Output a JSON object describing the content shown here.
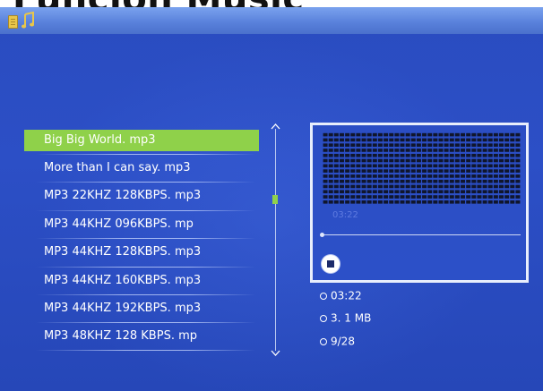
{
  "header": {
    "cut_text": "Funcion Music"
  },
  "topbar": {
    "icons": [
      "file-icon",
      "music-note-icon"
    ]
  },
  "playlist": {
    "selected_index": 0,
    "items": [
      "Big Big World. mp3",
      "More than I can say. mp3",
      "MP3 22KHZ 128KBPS. mp3",
      "MP3 44KHZ 096KBPS. mp",
      "MP3 44KHZ 128KBPS. mp3",
      "MP3 44KHZ 160KBPS. mp3",
      "MP3 44KHZ 192KBPS. mp3",
      "MP3 48KHZ 128 KBPS. mp"
    ]
  },
  "player": {
    "elapsed_label": "03:22",
    "stop_icon": "stop-icon"
  },
  "info": {
    "duration": "03:22",
    "size": "3. 1 MB",
    "track_position": "9/28"
  },
  "colors": {
    "background": "#2c4fc6",
    "selection": "#8fd14a",
    "topbar": "#5a82dc"
  }
}
